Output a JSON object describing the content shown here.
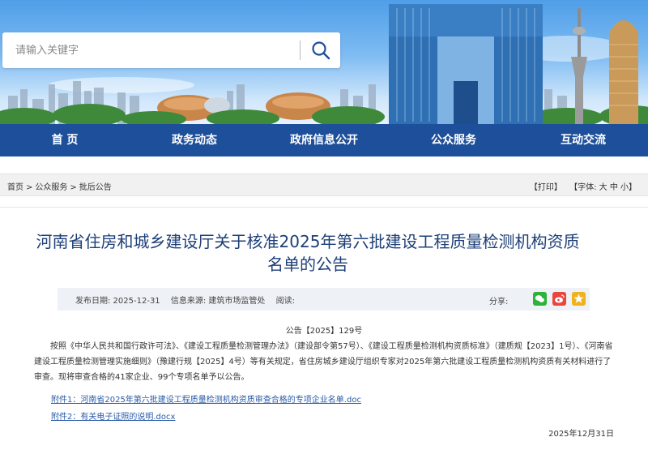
{
  "search": {
    "placeholder": "请输入关键字"
  },
  "nav": {
    "items": [
      {
        "label": "首 页"
      },
      {
        "label": "政务动态"
      },
      {
        "label": "政府信息公开"
      },
      {
        "label": "公众服务"
      },
      {
        "label": "互动交流"
      }
    ]
  },
  "breadcrumb": {
    "items": [
      "首页",
      "公众服务",
      "批后公告"
    ],
    "separator": ">",
    "print_label": "【打印】",
    "font_label": "【字体: 大 中 小】"
  },
  "article": {
    "title": "河南省住房和城乡建设厅关于核准2025年第六批建设工程质量检测机构资质名单的公告",
    "publish_date_label": "发布日期: 2025-12-31",
    "source_label": "信息来源: 建筑市场监管处",
    "views_label": "阅读:",
    "share_label": "分享:",
    "doc_number": "公告【2025】129号",
    "body": "按照《中华人民共和国行政许可法》、《建设工程质量检测管理办法》（建设部令第57号）、《建设工程质量检测机构资质标准》（建质规【2023】1号）、《河南省建设工程质量检测管理实施细则》（豫建行规【2025】4号）等有关规定，省住房城乡建设厅组织专家对2025年第六批建设工程质量检测机构资质有关材料进行了审查。现将审查合格的41家企业、99个专项名单予以公告。",
    "attachments": [
      "附件1：河南省2025年第六批建设工程质量检测机构资质审查合格的专项企业名单.doc",
      "附件2：有关电子证照的说明.docx"
    ],
    "date_signed": "2025年12月31日"
  },
  "colors": {
    "nav_bg": "#1d4f9a",
    "title": "#1d3f78",
    "link": "#2a5ba8",
    "wechat": "#2bb33b",
    "weibo": "#e9463c",
    "favorite": "#f0b21c"
  },
  "icons": [
    "search-icon",
    "wechat-icon",
    "weibo-icon",
    "star-icon"
  ]
}
